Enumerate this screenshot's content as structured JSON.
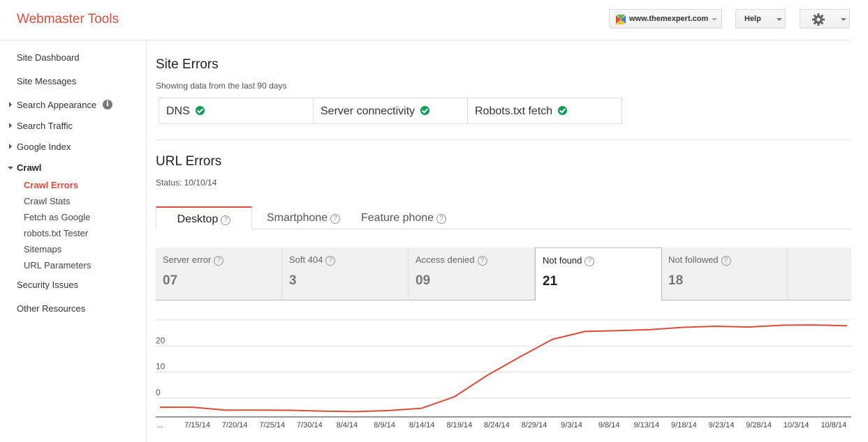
{
  "header": {
    "app_title": "Webmaster Tools",
    "site_selector": "www.themexpert.com",
    "help_label": "Help",
    "icons": {
      "site_logo": "themexpert-logo-icon",
      "settings": "gear-icon"
    }
  },
  "sidebar": {
    "items": [
      {
        "label": "Site Dashboard"
      },
      {
        "label": "Site Messages"
      },
      {
        "label": "Search Appearance",
        "icon": "info-icon"
      },
      {
        "label": "Search Traffic"
      },
      {
        "label": "Google Index"
      },
      {
        "label": "Crawl"
      },
      {
        "label": "Security Issues"
      },
      {
        "label": "Other Resources"
      }
    ],
    "crawl_children": [
      {
        "label": "Crawl Errors"
      },
      {
        "label": "Crawl Stats"
      },
      {
        "label": "Fetch as Google"
      },
      {
        "label": "robots.txt Tester"
      },
      {
        "label": "Sitemaps"
      },
      {
        "label": "URL Parameters"
      }
    ],
    "info_glyph": "i"
  },
  "site_errors": {
    "title": "Site Errors",
    "subtitle": "Showing data from the last 90 days",
    "checks": [
      {
        "label": "DNS"
      },
      {
        "label": "Server connectivity"
      },
      {
        "label": "Robots.txt fetch"
      }
    ],
    "ok_color": "#0f9d58"
  },
  "url_errors": {
    "title": "URL Errors",
    "status": "Status: 10/10/14",
    "tabs": [
      {
        "label": "Desktop"
      },
      {
        "label": "Smartphone"
      },
      {
        "label": "Feature phone"
      }
    ],
    "help_glyph": "?",
    "cards": [
      {
        "label": "Server error",
        "value": "07"
      },
      {
        "label": "Soft 404",
        "value": "3"
      },
      {
        "label": "Access denied",
        "value": "09"
      },
      {
        "label": "Not found",
        "value": "21"
      },
      {
        "label": "Not followed",
        "value": "18"
      }
    ]
  },
  "chart_data": {
    "type": "line",
    "x": [
      "...",
      "7/15/14",
      "7/20/14",
      "7/25/14",
      "7/30/14",
      "8/4/14",
      "8/9/14",
      "8/14/14",
      "8/19/14",
      "8/24/14",
      "8/29/14",
      "9/3/14",
      "9/8/14",
      "9/13/14",
      "9/18/14",
      "9/23/14",
      "9/28/14",
      "10/3/14",
      "10/8/14"
    ],
    "yticks": [
      "0",
      "10",
      "20",
      "30"
    ],
    "ylim": [
      0,
      30
    ],
    "series": [
      {
        "color": "#dd4b39",
        "values": [
          -3.5,
          -3.5,
          -4.6,
          -4.6,
          -4.7,
          -5.0,
          -5.2,
          -4.8,
          -3.9,
          0.5,
          8.7,
          15.8,
          22.6,
          25.6,
          25.9,
          26.3,
          27.2,
          27.6,
          27.3,
          28.0,
          28.1,
          27.8
        ]
      }
    ],
    "grid": true,
    "legend": "none"
  }
}
